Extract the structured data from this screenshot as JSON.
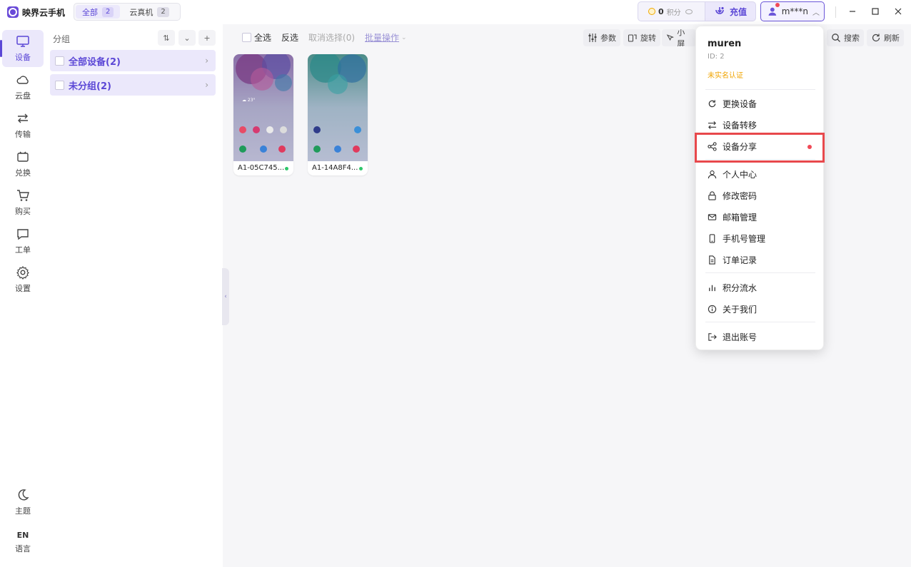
{
  "app": {
    "title": "映界云手机"
  },
  "top_tabs": [
    {
      "label": "全部",
      "count": "2"
    },
    {
      "label": "云真机",
      "count": "2"
    }
  ],
  "header": {
    "points_value": "0",
    "points_label": "积分",
    "recharge_label": "充值",
    "user_label": "m***n"
  },
  "nav": {
    "items": [
      {
        "label": "设备",
        "icon": "monitor-icon"
      },
      {
        "label": "云盘",
        "icon": "cloud-icon"
      },
      {
        "label": "传输",
        "icon": "transfer-icon"
      },
      {
        "label": "兑换",
        "icon": "ticket-icon"
      },
      {
        "label": "购买",
        "icon": "cart-icon"
      },
      {
        "label": "工单",
        "icon": "message-icon"
      },
      {
        "label": "设置",
        "icon": "gear-icon"
      }
    ],
    "theme_label": "主题",
    "lang_code": "EN",
    "lang_label": "语言"
  },
  "groups": {
    "title": "分组",
    "rows": [
      {
        "label": "全部设备(2)"
      },
      {
        "label": "未分组(2)"
      }
    ]
  },
  "toolbar": {
    "select_all": "全选",
    "invert": "反选",
    "cancel_select": "取消选择(0)",
    "batch": "批量操作",
    "params": "参数",
    "rotate": "旋转",
    "small_screen": "小屏",
    "search": "搜索",
    "refresh": "刷新"
  },
  "devices": [
    {
      "name": "A1-05C745...",
      "status": "online"
    },
    {
      "name": "A1-14A8F4...",
      "status": "online"
    }
  ],
  "user_menu": {
    "username": "muren",
    "id_text": "ID: 2",
    "verify_text": "未实名认证",
    "items": [
      {
        "label": "更换设备",
        "icon": "refresh-icon"
      },
      {
        "label": "设备转移",
        "icon": "swap-icon"
      },
      {
        "label": "设备分享",
        "icon": "share-icon"
      },
      {
        "label": "个人中心",
        "icon": "user-icon"
      },
      {
        "label": "修改密码",
        "icon": "lock-icon"
      },
      {
        "label": "邮箱管理",
        "icon": "mail-icon"
      },
      {
        "label": "手机号管理",
        "icon": "phone-icon"
      },
      {
        "label": "订单记录",
        "icon": "document-icon"
      },
      {
        "label": "积分流水",
        "icon": "bar-chart-icon"
      },
      {
        "label": "关于我们",
        "icon": "info-icon"
      },
      {
        "label": "退出账号",
        "icon": "logout-icon"
      }
    ]
  },
  "colors": {
    "accent": "#5b47d6",
    "highlight": "#e8484c",
    "online": "#2ec66a"
  }
}
